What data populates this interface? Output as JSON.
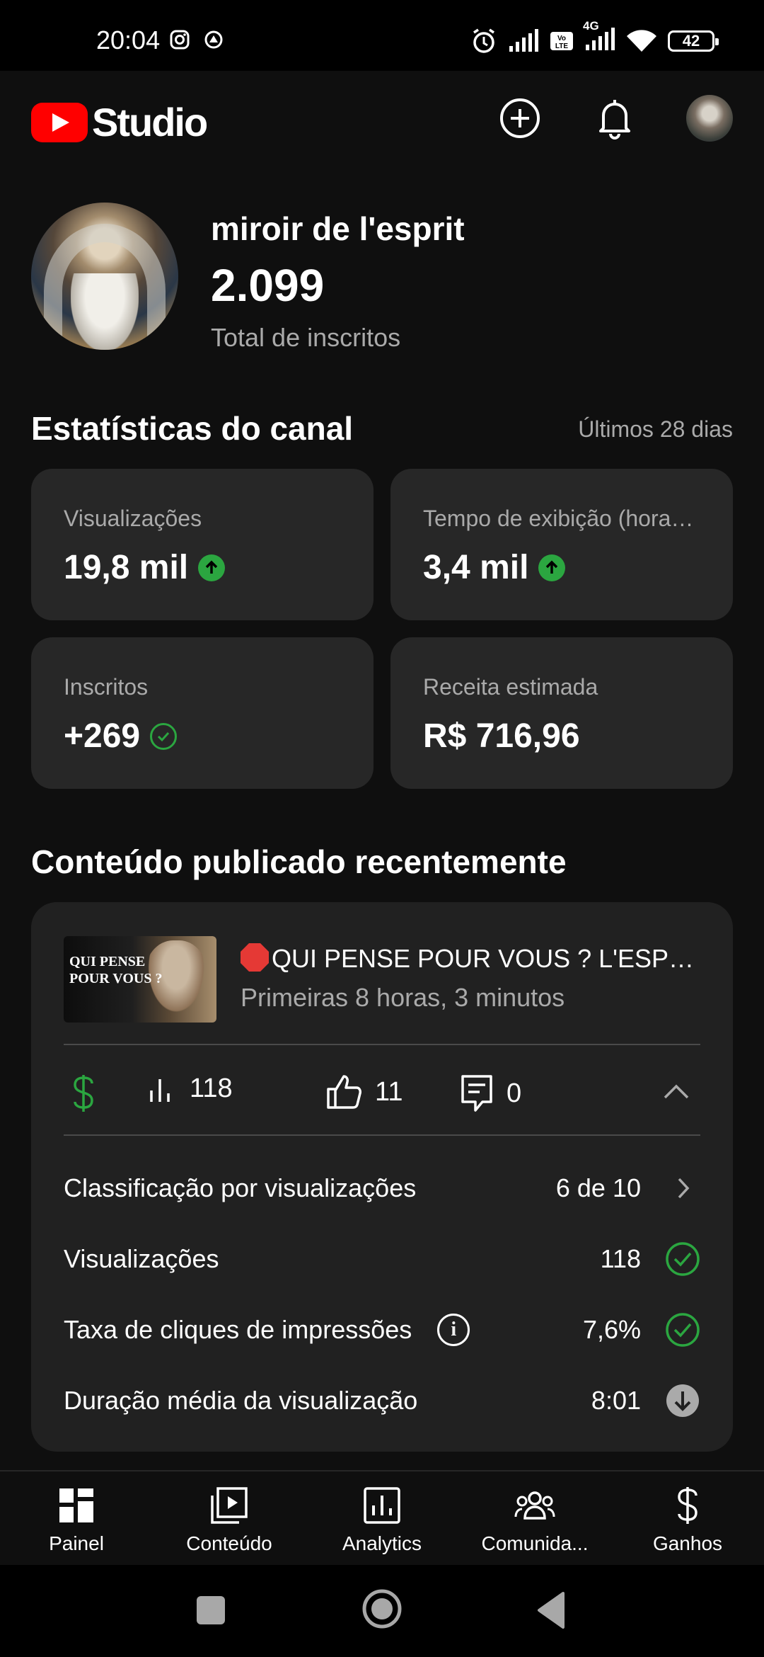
{
  "status_bar": {
    "time": "20:04",
    "battery": "42",
    "network": "4G",
    "icons": [
      "instagram-icon",
      "vpn-icon",
      "alarm-icon",
      "signal-icon",
      "volte-icon",
      "signal-icon",
      "wifi-icon",
      "battery-icon"
    ]
  },
  "app_bar": {
    "logo_text": "Studio",
    "icons": [
      "create-icon",
      "notifications-icon",
      "account-avatar"
    ]
  },
  "channel": {
    "name": "miroir de l'esprit",
    "subscribers": "2.099",
    "subscribers_label": "Total de inscritos"
  },
  "stats": {
    "title": "Estatísticas do canal",
    "period": "Últimos 28 dias",
    "cards": [
      {
        "label": "Visualizações",
        "value": "19,8 mil",
        "trend": "up"
      },
      {
        "label": "Tempo de exibição (hora…",
        "value": "3,4 mil",
        "trend": "up"
      },
      {
        "label": "Inscritos",
        "value": "+269",
        "trend": "check"
      },
      {
        "label": "Receita estimada",
        "value": "R$ 716,96",
        "trend": "none"
      }
    ]
  },
  "recent": {
    "title": "Conteúdo publicado recentemente",
    "video": {
      "thumbnail_text_line1": "QUI PENSE",
      "thumbnail_text_line2": "POUR VOUS ?",
      "title": "QUI PENSE POUR VOUS ? L'ESPR...",
      "meta": "Primeiras 8 horas, 3 minutos",
      "views": "118",
      "likes": "11",
      "comments": "0"
    },
    "details": [
      {
        "label": "Classificação por visualizações",
        "value": "6 de 10",
        "icon": "chevron-right-icon"
      },
      {
        "label": "Visualizações",
        "value": "118",
        "icon": "check-icon"
      },
      {
        "label": "Taxa de cliques de impressões",
        "value": "7,6%",
        "icon": "check-icon"
      },
      {
        "label": "Duração média da visualização",
        "value": "8:01",
        "icon": "down-arrow-icon"
      }
    ]
  },
  "bottom_nav": [
    {
      "label": "Painel",
      "icon": "dashboard-icon"
    },
    {
      "label": "Conteúdo",
      "icon": "content-icon"
    },
    {
      "label": "Analytics",
      "icon": "analytics-icon"
    },
    {
      "label": "Comunida...",
      "icon": "community-icon"
    },
    {
      "label": "Ganhos",
      "icon": "earn-icon"
    }
  ],
  "colors": {
    "background": "#0f0f0f",
    "card": "#272727",
    "accent_green": "#2ba640",
    "brand_red": "#ff0000",
    "muted_text": "#aaaaaa"
  }
}
